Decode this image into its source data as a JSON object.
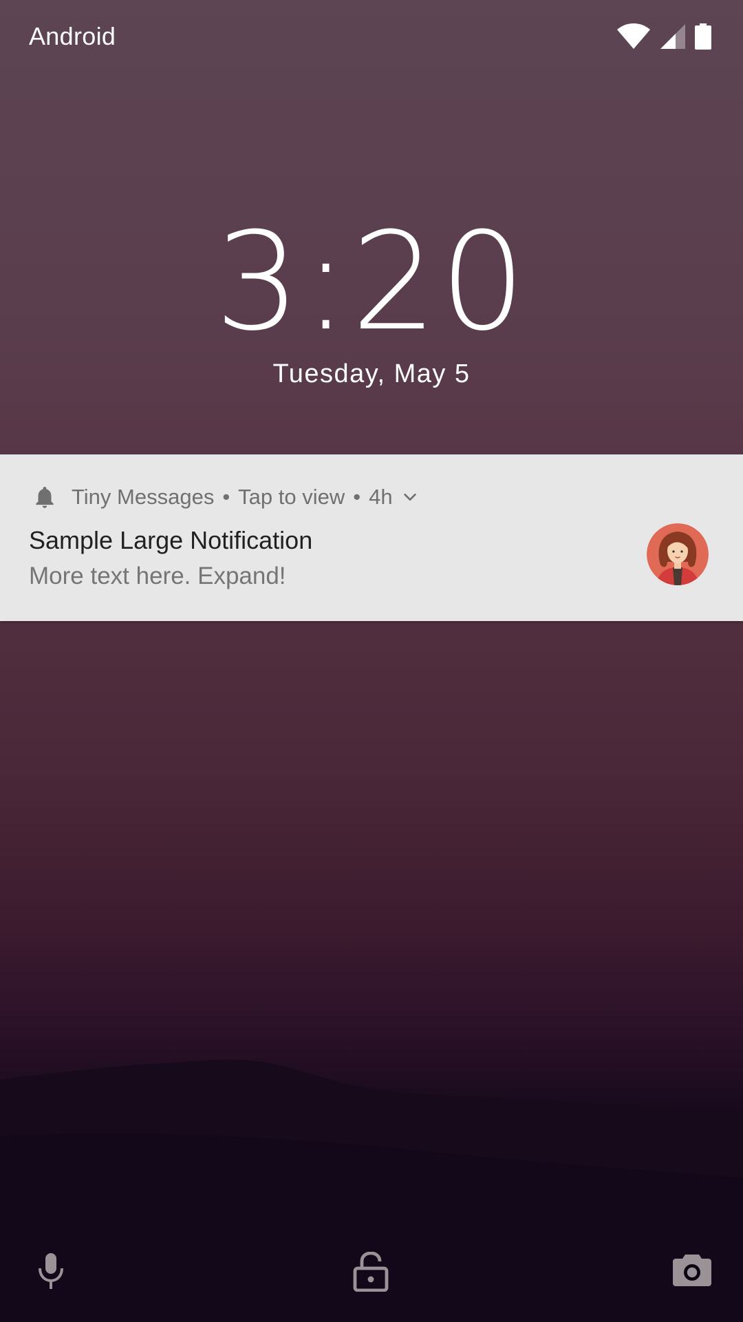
{
  "status_bar": {
    "carrier": "Android",
    "icons": [
      "wifi-icon",
      "cell-signal-icon",
      "battery-icon"
    ]
  },
  "lockscreen": {
    "time": "3:20",
    "date": "Tuesday, May 5"
  },
  "notification": {
    "app_name": "Tiny Messages",
    "separator": "•",
    "subtext": "Tap to view",
    "time_ago": "4h",
    "title": "Sample Large Notification",
    "text": "More text here. Expand!",
    "icon": "bell-icon",
    "expand_icon": "chevron-down-icon",
    "large_icon": "avatar"
  },
  "bottom_bar": {
    "left": "mic-icon",
    "center": "lock-icon",
    "right": "camera-icon"
  },
  "colors": {
    "wallpaper_top": "#5d4553",
    "wallpaper_bottom": "#0b0512",
    "notification_bg": "#e7e7e7",
    "notification_title": "#212121",
    "notification_secondary": "#757575"
  }
}
